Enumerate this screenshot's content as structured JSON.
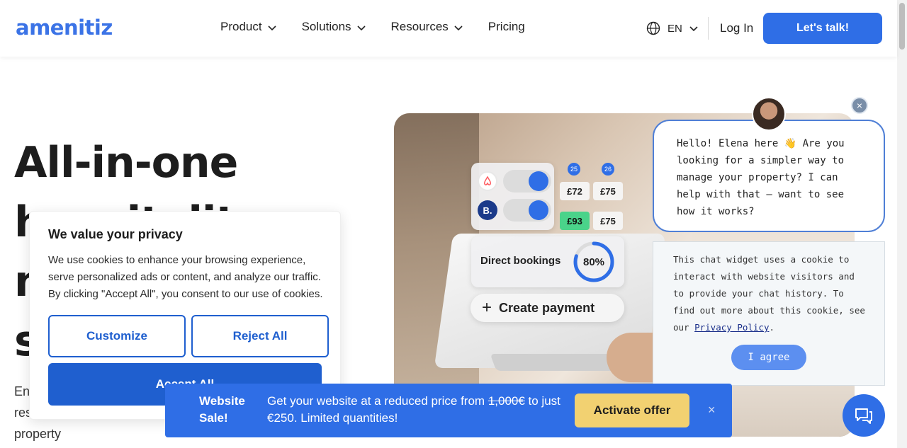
{
  "header": {
    "logo": "amenitiz",
    "nav": [
      {
        "label": "Product",
        "has_dropdown": true
      },
      {
        "label": "Solutions",
        "has_dropdown": true
      },
      {
        "label": "Resources",
        "has_dropdown": true
      },
      {
        "label": "Pricing",
        "has_dropdown": false
      }
    ],
    "language": "EN",
    "login": "Log In",
    "cta": "Let's talk!"
  },
  "hero": {
    "title_lines": [
      "All-in-one",
      "hospitality",
      "m",
      "s"
    ],
    "subtitle_lines": [
      "En",
      "res",
      "property"
    ]
  },
  "hero_image": {
    "day_badges": [
      "25",
      "26"
    ],
    "prices": [
      "£72",
      "£75",
      "£93",
      "£75"
    ],
    "direct_bookings_label": "Direct bookings",
    "direct_bookings_value": "80%",
    "direct_bookings_fraction": 0.8,
    "create_payment": "Create payment",
    "booking_logo_text": "B."
  },
  "chat": {
    "message": "Hello! Elena here 👋  Are you looking for a simpler way to manage your property?  I can help with that — want to see how it works?",
    "cookie_text": "This chat widget uses a cookie to interact with website visitors and to provide your chat history. To find out more about this cookie, see our ",
    "cookie_link": "Privacy Policy",
    "cookie_end": ".",
    "agree": "I agree",
    "close": "×"
  },
  "privacy": {
    "title": "We value your privacy",
    "body": "We use cookies to enhance your browsing experience, serve personalized ads or content, and analyze our traffic. By clicking \"Accept All\", you consent to our use of cookies.",
    "customize": "Customize",
    "reject": "Reject All",
    "accept": "Accept All"
  },
  "sale_banner": {
    "title": "Website Sale!",
    "text_before": "Get your website at a reduced price from ",
    "old_price": "1,000€",
    "text_after": " to just €250. Limited quantities!",
    "cta": "Activate offer",
    "close": "×"
  },
  "colors": {
    "brand_blue": "#2f6ee6",
    "privacy_blue": "#1f5fcf",
    "offer_yellow": "#f2d171",
    "chat_border": "#4f7fd6"
  }
}
